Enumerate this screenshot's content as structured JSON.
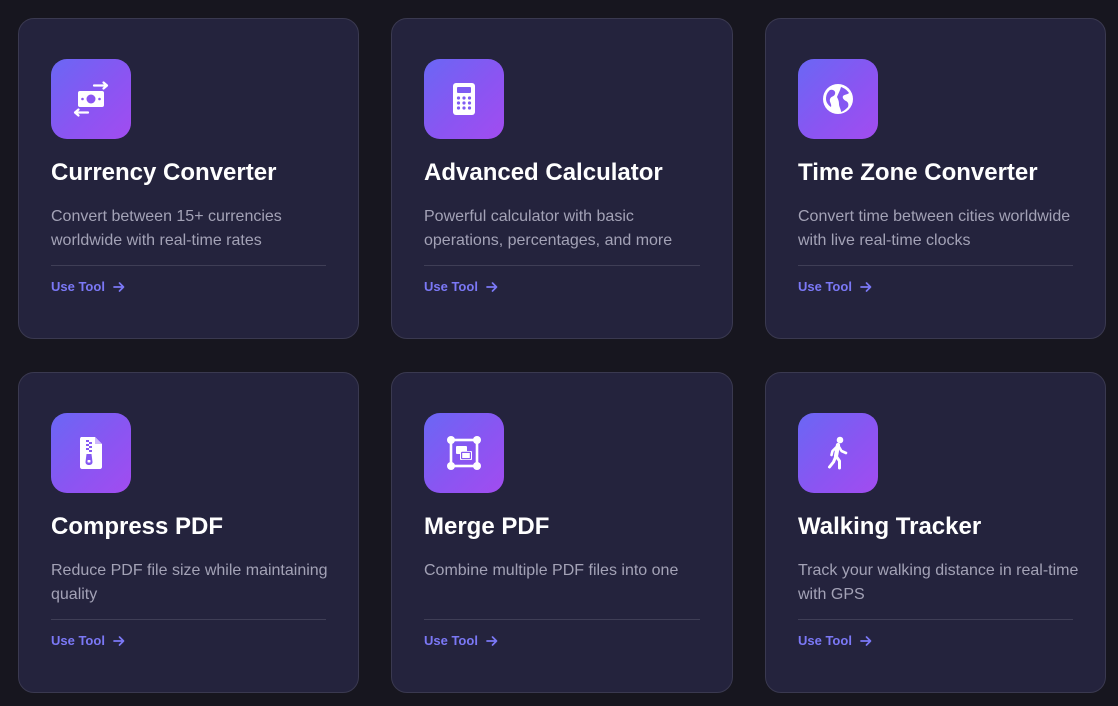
{
  "accent_color": "#7b78f6",
  "cards": [
    {
      "icon": "money-exchange-icon",
      "title": "Currency Converter",
      "description": "Convert between 15+ currencies worldwide with real-time rates",
      "cta": "Use Tool"
    },
    {
      "icon": "calculator-icon",
      "title": "Advanced Calculator",
      "description": "Powerful calculator with basic operations, percentages, and more",
      "cta": "Use Tool"
    },
    {
      "icon": "globe-icon",
      "title": "Time Zone Converter",
      "description": "Convert time between cities worldwide with live real-time clocks",
      "cta": "Use Tool"
    },
    {
      "icon": "zip-file-icon",
      "title": "Compress PDF",
      "description": "Reduce PDF file size while maintaining quality",
      "cta": "Use Tool"
    },
    {
      "icon": "object-group-icon",
      "title": "Merge PDF",
      "description": "Combine multiple PDF files into one",
      "cta": "Use Tool"
    },
    {
      "icon": "walking-person-icon",
      "title": "Walking Tracker",
      "description": "Track your walking distance in real-time with GPS",
      "cta": "Use Tool"
    }
  ]
}
